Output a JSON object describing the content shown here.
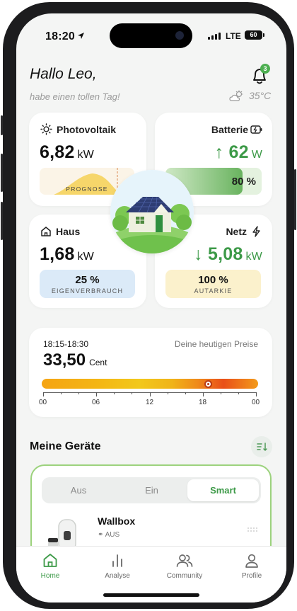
{
  "status": {
    "time": "18:20",
    "network": "LTE",
    "battery": "60"
  },
  "header": {
    "greeting": "Hallo Leo,",
    "subtitle": "habe einen tollen Tag!",
    "notification_count": "3",
    "temperature": "35°C"
  },
  "photovoltaik": {
    "title": "Photovoltaik",
    "value": "6,82",
    "unit": "kW",
    "forecast_label": "PROGNOSE"
  },
  "batterie": {
    "title": "Batterie",
    "value": "62",
    "unit": "W",
    "charge": "80 %",
    "charge_fraction": 0.8
  },
  "haus": {
    "title": "Haus",
    "value": "1,68",
    "unit": "kW",
    "pill_value": "25 %",
    "pill_label": "EIGENVERBRAUCH"
  },
  "netz": {
    "title": "Netz",
    "value": "5,08",
    "unit": "kW",
    "pill_value": "100 %",
    "pill_label": "AUTARKIE"
  },
  "prices": {
    "time_range": "18:15-18:30",
    "caption": "Deine heutigen Preise",
    "value": "33,50",
    "unit": "Cent",
    "ticks": [
      "00",
      "06",
      "12",
      "18",
      "00"
    ],
    "current_hour": 18.25
  },
  "devices": {
    "title": "Meine Geräte",
    "modes": [
      "Aus",
      "Ein",
      "Smart"
    ],
    "selected_mode": "Smart",
    "item_name": "Wallbox",
    "item_status": "AUS"
  },
  "tabs": [
    {
      "label": "Home",
      "icon": "home-icon",
      "active": true
    },
    {
      "label": "Analyse",
      "icon": "analyse-icon",
      "active": false
    },
    {
      "label": "Community",
      "icon": "community-icon",
      "active": false
    },
    {
      "label": "Profile",
      "icon": "profile-icon",
      "active": false
    }
  ],
  "colors": {
    "accent": "#3d9a48",
    "card": "#ffffff",
    "background": "#f4f5f4"
  }
}
